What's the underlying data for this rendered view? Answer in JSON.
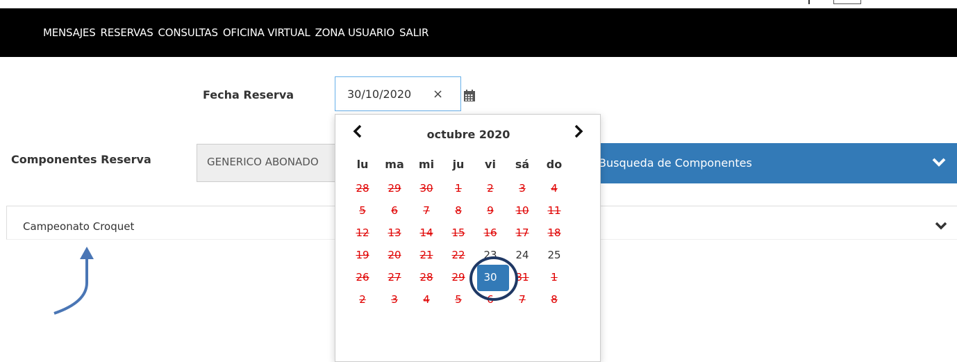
{
  "nav": {
    "items": [
      "MENSAJES",
      "RESERVAS",
      "CONSULTAS",
      "OFICINA VIRTUAL",
      "ZONA USUARIO",
      "SALIR"
    ]
  },
  "form": {
    "fecha_label": "Fecha Reserva",
    "fecha_value": "30/10/2020",
    "clear_symbol": "×",
    "componentes_label": "Componentes Reserva",
    "componentes_value": "GENERICO ABONADO",
    "search_label": "Busqueda de Componentes"
  },
  "list": {
    "item": "Campeonato Croquet"
  },
  "datepicker": {
    "title": "octubre 2020",
    "prev_symbol": "‹",
    "next_symbol": "›",
    "weekdays": [
      "lu",
      "ma",
      "mi",
      "ju",
      "vi",
      "sá",
      "do"
    ],
    "weeks": [
      [
        {
          "d": "28",
          "dis": true
        },
        {
          "d": "29",
          "dis": true
        },
        {
          "d": "30",
          "dis": true
        },
        {
          "d": "1",
          "dis": true
        },
        {
          "d": "2",
          "dis": true
        },
        {
          "d": "3",
          "dis": true
        },
        {
          "d": "4",
          "dis": true
        }
      ],
      [
        {
          "d": "5",
          "dis": true
        },
        {
          "d": "6",
          "dis": true
        },
        {
          "d": "7",
          "dis": true
        },
        {
          "d": "8",
          "dis": true
        },
        {
          "d": "9",
          "dis": true
        },
        {
          "d": "10",
          "dis": true
        },
        {
          "d": "11",
          "dis": true
        }
      ],
      [
        {
          "d": "12",
          "dis": true
        },
        {
          "d": "13",
          "dis": true
        },
        {
          "d": "14",
          "dis": true
        },
        {
          "d": "15",
          "dis": true
        },
        {
          "d": "16",
          "dis": true
        },
        {
          "d": "17",
          "dis": true
        },
        {
          "d": "18",
          "dis": true
        }
      ],
      [
        {
          "d": "19",
          "dis": true
        },
        {
          "d": "20",
          "dis": true
        },
        {
          "d": "21",
          "dis": true
        },
        {
          "d": "22",
          "dis": true
        },
        {
          "d": "23",
          "dis": false
        },
        {
          "d": "24",
          "dis": false
        },
        {
          "d": "25",
          "dis": false
        }
      ],
      [
        {
          "d": "26",
          "dis": true
        },
        {
          "d": "27",
          "dis": true
        },
        {
          "d": "28",
          "dis": true
        },
        {
          "d": "29",
          "dis": true
        },
        {
          "d": "30",
          "dis": false,
          "sel": true
        },
        {
          "d": "31",
          "dis": true
        },
        {
          "d": "1",
          "dis": true
        }
      ],
      [
        {
          "d": "2",
          "dis": true
        },
        {
          "d": "3",
          "dis": true
        },
        {
          "d": "4",
          "dis": true
        },
        {
          "d": "5",
          "dis": true
        },
        {
          "d": "6",
          "dis": true
        },
        {
          "d": "7",
          "dis": true
        },
        {
          "d": "8",
          "dis": true
        }
      ]
    ]
  },
  "icons": {
    "calendar": "calendar-icon",
    "chevron": "chevron-down-icon",
    "annotation_arrow": "arrow-annotation-icon",
    "annotation_circle": "highlight-circle"
  },
  "colors": {
    "navbar_bg": "#000000",
    "primary": "#337ab7",
    "disabled_day": "#e00000",
    "annotation": "#1f3864"
  }
}
